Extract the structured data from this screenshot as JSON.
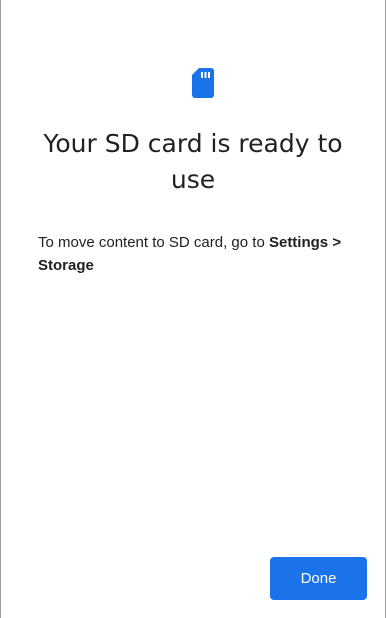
{
  "icon": {
    "name": "sd-card-icon",
    "color": "#1a73e8"
  },
  "title": "Your SD card is ready to use",
  "message": {
    "prefix": "To move content to SD card, go to ",
    "settings": "Settings",
    "separator": " ",
    "storage": "> Storage"
  },
  "actions": {
    "done_label": "Done"
  },
  "colors": {
    "accent": "#1a73e8",
    "text": "#202124",
    "background": "#ffffff"
  }
}
